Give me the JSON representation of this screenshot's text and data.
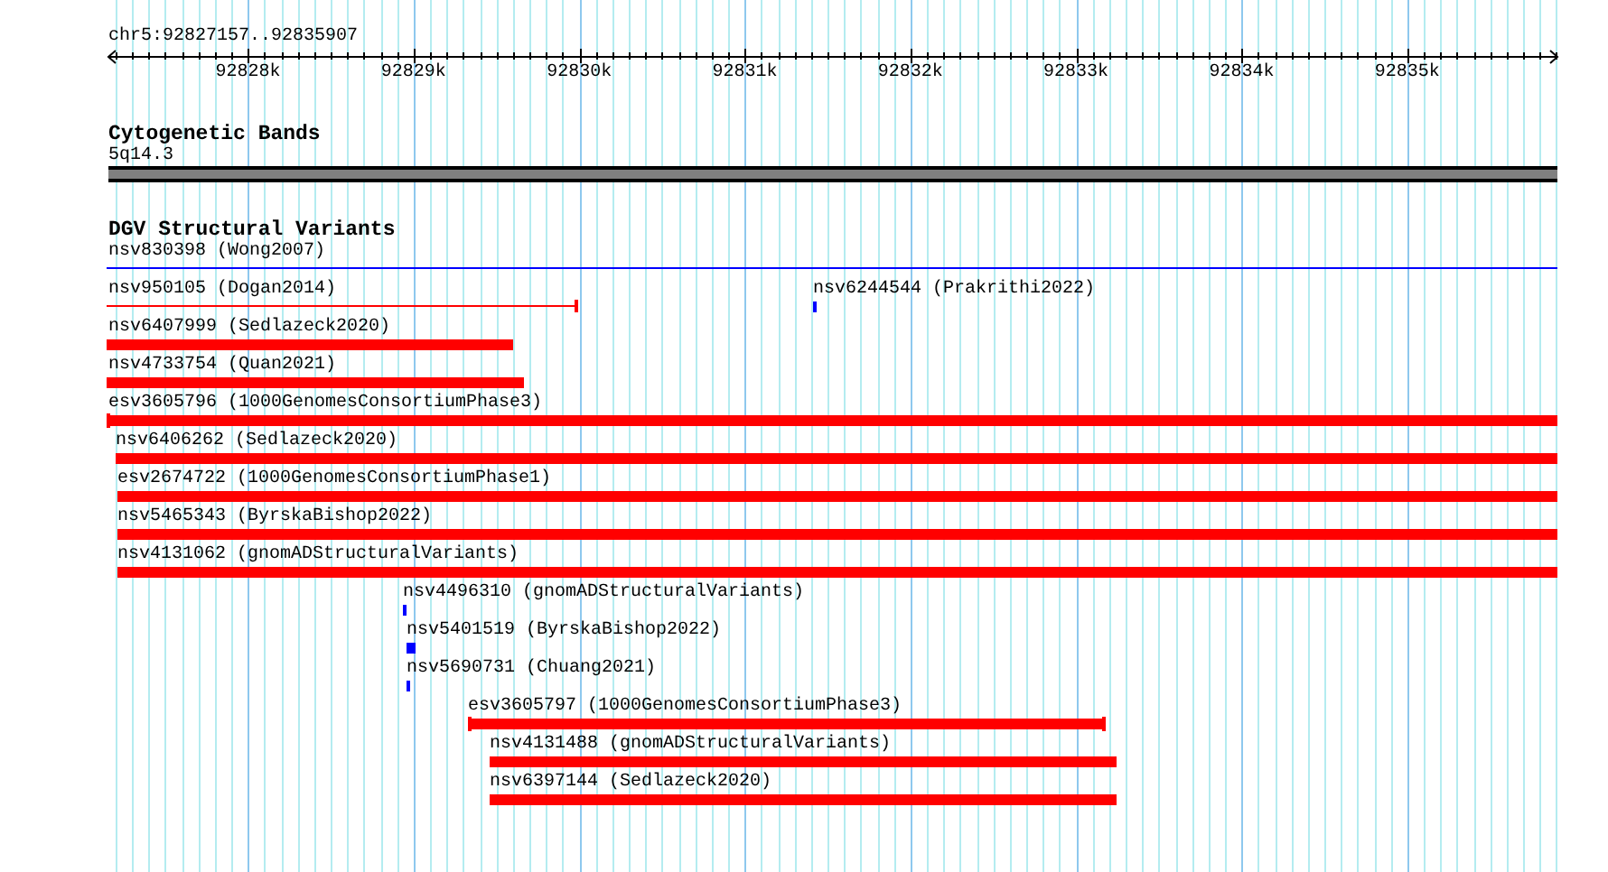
{
  "ruler": {
    "location": "chr5:92827157..92835907",
    "ticks": [
      {
        "label": "92828k"
      },
      {
        "label": "92829k"
      },
      {
        "label": "92830k"
      },
      {
        "label": "92831k"
      },
      {
        "label": "92832k"
      },
      {
        "label": "92833k"
      },
      {
        "label": "92834k"
      },
      {
        "label": "92835k"
      }
    ]
  },
  "tracks": [
    {
      "title": "Cytogenetic Bands",
      "kind": "bands",
      "rows": [
        {
          "features": [
            {
              "label": "5q14.3",
              "kind": "band",
              "color": "#808080"
            }
          ]
        }
      ]
    },
    {
      "title": "DGV Structural Variants",
      "kind": "variants",
      "rows": [
        {
          "features": [
            {
              "label": "nsv830398 (Wong2007)",
              "kind": "line",
              "color": "#0000ff"
            }
          ]
        },
        {
          "features": [
            {
              "label": "nsv950105 (Dogan2014)",
              "kind": "line",
              "color": "#ff0000"
            },
            {
              "label": "nsv6244544 (Prakrithi2022)",
              "kind": "bar",
              "color": "#0000ff"
            }
          ]
        },
        {
          "features": [
            {
              "label": "nsv6407999 (Sedlazeck2020)",
              "kind": "bar",
              "color": "#ff0000"
            }
          ]
        },
        {
          "features": [
            {
              "label": "nsv4733754 (Quan2021)",
              "kind": "bar",
              "color": "#ff0000"
            }
          ]
        },
        {
          "features": [
            {
              "label": "esv3605796 (1000GenomesConsortiumPhase3)",
              "kind": "bar",
              "color": "#ff0000"
            }
          ]
        },
        {
          "features": [
            {
              "label": "nsv6406262 (Sedlazeck2020)",
              "kind": "bar",
              "color": "#ff0000"
            }
          ]
        },
        {
          "features": [
            {
              "label": "esv2674722 (1000GenomesConsortiumPhase1)",
              "kind": "bar",
              "color": "#ff0000"
            }
          ]
        },
        {
          "features": [
            {
              "label": "nsv5465343 (ByrskaBishop2022)",
              "kind": "bar",
              "color": "#ff0000"
            }
          ]
        },
        {
          "features": [
            {
              "label": "nsv4131062 (gnomADStructuralVariants)",
              "kind": "bar",
              "color": "#ff0000"
            }
          ]
        },
        {
          "features": [
            {
              "label": "nsv4496310 (gnomADStructuralVariants)",
              "kind": "bar",
              "color": "#0000ff"
            }
          ]
        },
        {
          "features": [
            {
              "label": "nsv5401519 (ByrskaBishop2022)",
              "kind": "bar",
              "color": "#0000ff"
            }
          ]
        },
        {
          "features": [
            {
              "label": "nsv5690731 (Chuang2021)",
              "kind": "bar",
              "color": "#0000ff"
            }
          ]
        },
        {
          "features": [
            {
              "label": "esv3605797 (1000GenomesConsortiumPhase3)",
              "kind": "bar",
              "color": "#ff0000"
            }
          ]
        },
        {
          "features": [
            {
              "label": "nsv4131488 (gnomADStructuralVariants)",
              "kind": "bar",
              "color": "#ff0000"
            }
          ]
        },
        {
          "features": [
            {
              "label": "nsv6397144 (Sedlazeck2020)",
              "kind": "bar",
              "color": "#ff0000"
            }
          ]
        }
      ]
    }
  ]
}
